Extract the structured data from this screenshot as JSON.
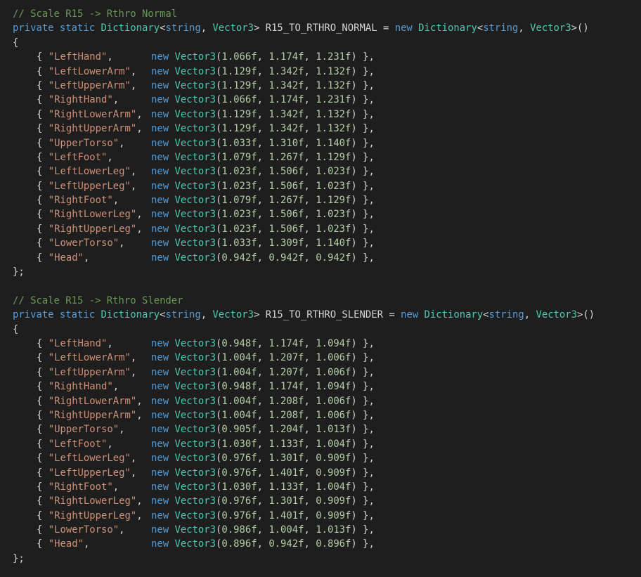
{
  "editor": {
    "blocks": [
      {
        "comment": "// Scale R15 -> Rthro Normal",
        "decl": {
          "modifiers": [
            "private",
            "static"
          ],
          "type_name": "Dictionary",
          "key_type": "string",
          "value_type": "Vector3",
          "var_name": "R15_TO_RTHRO_NORMAL",
          "new_kw": "new"
        },
        "entries": [
          {
            "key": "LeftHand",
            "x": "1.066f",
            "y": "1.174f",
            "z": "1.231f"
          },
          {
            "key": "LeftLowerArm",
            "x": "1.129f",
            "y": "1.342f",
            "z": "1.132f"
          },
          {
            "key": "LeftUpperArm",
            "x": "1.129f",
            "y": "1.342f",
            "z": "1.132f"
          },
          {
            "key": "RightHand",
            "x": "1.066f",
            "y": "1.174f",
            "z": "1.231f"
          },
          {
            "key": "RightLowerArm",
            "x": "1.129f",
            "y": "1.342f",
            "z": "1.132f"
          },
          {
            "key": "RightUpperArm",
            "x": "1.129f",
            "y": "1.342f",
            "z": "1.132f"
          },
          {
            "key": "UpperTorso",
            "x": "1.033f",
            "y": "1.310f",
            "z": "1.140f"
          },
          {
            "key": "LeftFoot",
            "x": "1.079f",
            "y": "1.267f",
            "z": "1.129f"
          },
          {
            "key": "LeftLowerLeg",
            "x": "1.023f",
            "y": "1.506f",
            "z": "1.023f"
          },
          {
            "key": "LeftUpperLeg",
            "x": "1.023f",
            "y": "1.506f",
            "z": "1.023f"
          },
          {
            "key": "RightFoot",
            "x": "1.079f",
            "y": "1.267f",
            "z": "1.129f"
          },
          {
            "key": "RightLowerLeg",
            "x": "1.023f",
            "y": "1.506f",
            "z": "1.023f"
          },
          {
            "key": "RightUpperLeg",
            "x": "1.023f",
            "y": "1.506f",
            "z": "1.023f"
          },
          {
            "key": "LowerTorso",
            "x": "1.033f",
            "y": "1.309f",
            "z": "1.140f"
          },
          {
            "key": "Head",
            "x": "0.942f",
            "y": "0.942f",
            "z": "0.942f"
          }
        ]
      },
      {
        "comment": "// Scale R15 -> Rthro Slender",
        "decl": {
          "modifiers": [
            "private",
            "static"
          ],
          "type_name": "Dictionary",
          "key_type": "string",
          "value_type": "Vector3",
          "var_name": "R15_TO_RTHRO_SLENDER",
          "new_kw": "new"
        },
        "entries": [
          {
            "key": "LeftHand",
            "x": "0.948f",
            "y": "1.174f",
            "z": "1.094f"
          },
          {
            "key": "LeftLowerArm",
            "x": "1.004f",
            "y": "1.207f",
            "z": "1.006f"
          },
          {
            "key": "LeftUpperArm",
            "x": "1.004f",
            "y": "1.207f",
            "z": "1.006f"
          },
          {
            "key": "RightHand",
            "x": "0.948f",
            "y": "1.174f",
            "z": "1.094f"
          },
          {
            "key": "RightLowerArm",
            "x": "1.004f",
            "y": "1.208f",
            "z": "1.006f"
          },
          {
            "key": "RightUpperArm",
            "x": "1.004f",
            "y": "1.208f",
            "z": "1.006f"
          },
          {
            "key": "UpperTorso",
            "x": "0.905f",
            "y": "1.204f",
            "z": "1.013f"
          },
          {
            "key": "LeftFoot",
            "x": "1.030f",
            "y": "1.133f",
            "z": "1.004f"
          },
          {
            "key": "LeftLowerLeg",
            "x": "0.976f",
            "y": "1.301f",
            "z": "0.909f"
          },
          {
            "key": "LeftUpperLeg",
            "x": "0.976f",
            "y": "1.401f",
            "z": "0.909f"
          },
          {
            "key": "RightFoot",
            "x": "1.030f",
            "y": "1.133f",
            "z": "1.004f"
          },
          {
            "key": "RightLowerLeg",
            "x": "0.976f",
            "y": "1.301f",
            "z": "0.909f"
          },
          {
            "key": "RightUpperLeg",
            "x": "0.976f",
            "y": "1.401f",
            "z": "0.909f"
          },
          {
            "key": "LowerTorso",
            "x": "0.986f",
            "y": "1.004f",
            "z": "1.013f"
          },
          {
            "key": "Head",
            "x": "0.896f",
            "y": "0.942f",
            "z": "0.896f"
          }
        ]
      }
    ],
    "syntax_colors": {
      "background": "#1e1e1e",
      "keyword": "#569cd6",
      "type": "#4ec9b0",
      "string": "#ce9178",
      "number": "#b5cea8",
      "comment": "#6a9955",
      "default": "#d4d4d4"
    }
  }
}
